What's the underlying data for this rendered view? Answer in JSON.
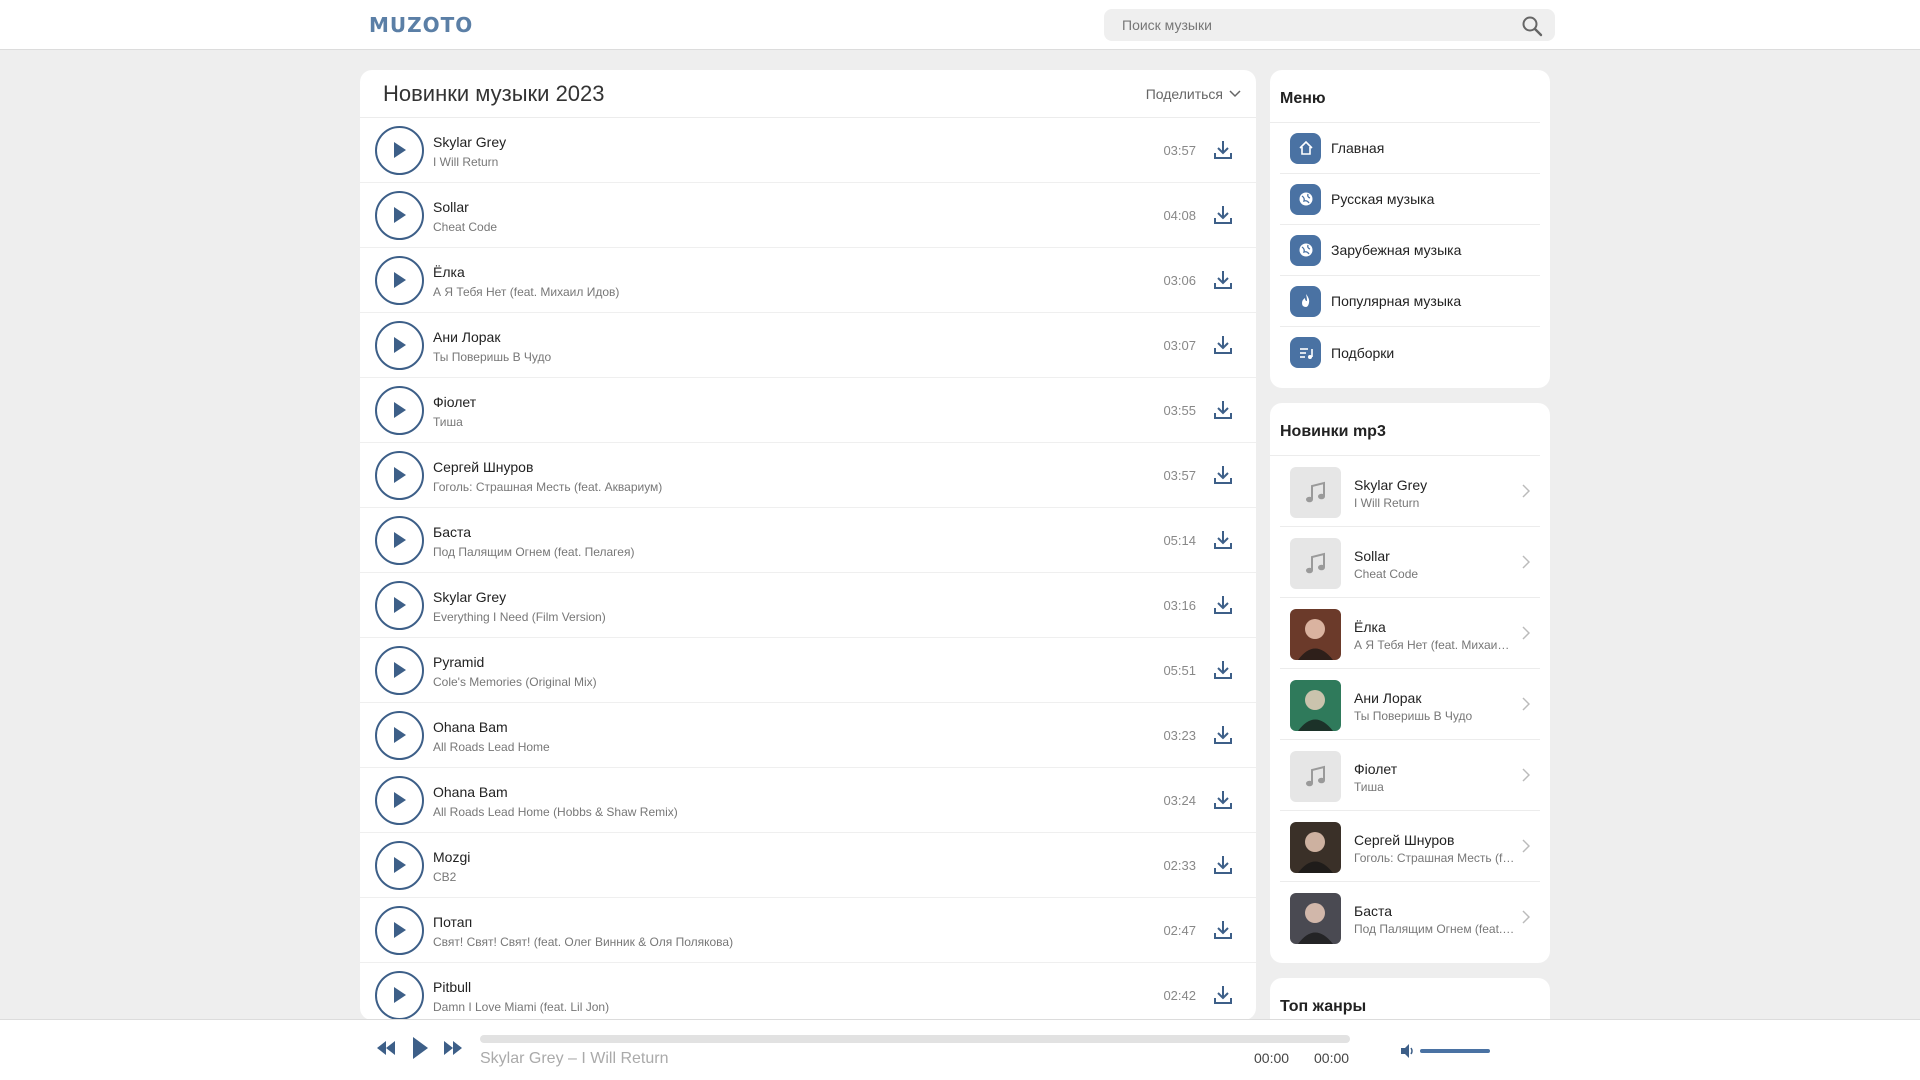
{
  "header": {
    "logo": "MUZOTO",
    "search_placeholder": "Поиск музыки"
  },
  "main": {
    "title": "Новинки музыки 2023",
    "share_label": "Поделиться",
    "tracks": [
      {
        "artist": "Skylar Grey",
        "title": "I Will Return",
        "duration": "03:57"
      },
      {
        "artist": "Sollar",
        "title": "Cheat Code",
        "duration": "04:08"
      },
      {
        "artist": "Ёлка",
        "title": "А Я Тебя Нет (feat. Михаил Идов)",
        "duration": "03:06"
      },
      {
        "artist": "Ани Лорак",
        "title": "Ты Поверишь В Чудо",
        "duration": "03:07"
      },
      {
        "artist": "Фіолет",
        "title": "Тиша",
        "duration": "03:55"
      },
      {
        "artist": "Сергей Шнуров",
        "title": "Гоголь: Страшная Месть (feat. Аквариум)",
        "duration": "03:57"
      },
      {
        "artist": "Баста",
        "title": "Под Палящим Огнем (feat. Пелагея)",
        "duration": "05:14"
      },
      {
        "artist": "Skylar Grey",
        "title": "Everything I Need (Film Version)",
        "duration": "03:16"
      },
      {
        "artist": "Pyramid",
        "title": "Cole's Memories (Original Mix)",
        "duration": "05:51"
      },
      {
        "artist": "Ohana Bam",
        "title": "All Roads Lead Home",
        "duration": "03:23"
      },
      {
        "artist": "Ohana Bam",
        "title": "All Roads Lead Home (Hobbs & Shaw Remix)",
        "duration": "03:24"
      },
      {
        "artist": "Mozgi",
        "title": "СВ2",
        "duration": "02:33"
      },
      {
        "artist": "Потап",
        "title": "Свят! Свят! Свят! (feat. Олег Винник & Оля Полякова)",
        "duration": "02:47"
      },
      {
        "artist": "Pitbull",
        "title": "Damn I Love Miami (feat. Lil Jon)",
        "duration": "02:42"
      }
    ]
  },
  "menu": {
    "title": "Меню",
    "items": [
      {
        "label": "Главная",
        "icon": "home-icon"
      },
      {
        "label": "Русская музыка",
        "icon": "globe-icon"
      },
      {
        "label": "Зарубежная музыка",
        "icon": "globe-icon"
      },
      {
        "label": "Популярная музыка",
        "icon": "flame-icon"
      },
      {
        "label": "Подборки",
        "icon": "playlist-icon"
      }
    ]
  },
  "new_mp3": {
    "title": "Новинки mp3",
    "items": [
      {
        "artist": "Skylar Grey",
        "title": "I Will Return",
        "cover": "placeholder"
      },
      {
        "artist": "Sollar",
        "title": "Cheat Code",
        "cover": "placeholder"
      },
      {
        "artist": "Ёлка",
        "title": "А Я Тебя Нет (feat. Михаил Идов)",
        "cover": "photo"
      },
      {
        "artist": "Ани Лорак",
        "title": "Ты Поверишь В Чудо",
        "cover": "photo"
      },
      {
        "artist": "Фіолет",
        "title": "Тиша",
        "cover": "placeholder"
      },
      {
        "artist": "Сергей Шнуров",
        "title": "Гоголь: Страшная Месть (feat. Аквариум)",
        "cover": "photo"
      },
      {
        "artist": "Баста",
        "title": "Под Палящим Огнем (feat. Пелагея)",
        "cover": "photo"
      }
    ]
  },
  "top_genres": {
    "title": "Топ жанры"
  },
  "player": {
    "now_playing": "Skylar Grey – I Will Return",
    "current_time": "00:00",
    "total_time": "00:00",
    "progress": 0
  },
  "colors": {
    "accent": "#4a72a3",
    "play_border": "#3d5f88"
  }
}
